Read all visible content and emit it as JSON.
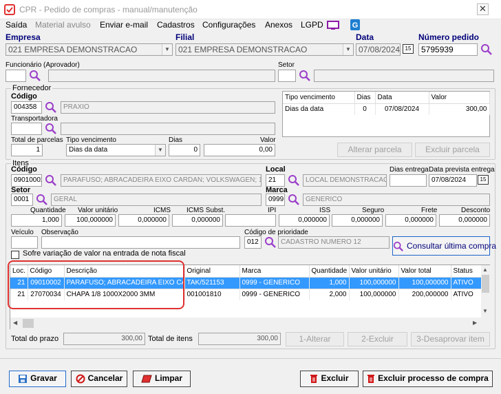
{
  "window": {
    "title": "CPR - Pedido de compras - manual/manutenção",
    "close": "✕"
  },
  "menu": [
    {
      "label": "Saída",
      "enabled": true
    },
    {
      "label": "Material avulso",
      "enabled": false
    },
    {
      "label": "Enviar e-mail",
      "enabled": true
    },
    {
      "label": "Cadastros",
      "enabled": true
    },
    {
      "label": "Configurações",
      "enabled": true
    },
    {
      "label": "Anexos",
      "enabled": true
    },
    {
      "label": "LGPD",
      "enabled": true
    }
  ],
  "header": {
    "empresa_label": "Empresa",
    "empresa_value": "021 EMPRESA DEMONSTRACAO",
    "filial_label": "Filial",
    "filial_value": "021 EMPRESA DEMONSTRACAO",
    "data_label": "Data",
    "data_value": "07/08/2024",
    "cal_icon": "15",
    "numero_label": "Número pedido",
    "numero_value": "5795939",
    "funcionario_label": "Funcionário (Aprovador)",
    "setor_label": "Setor"
  },
  "fornecedor": {
    "title": "Fornecedor",
    "codigo_label": "Código",
    "codigo_value": "004358",
    "nome_value": "PRAXIO",
    "transportadora_label": "Transportadora",
    "total_parcelas_label": "Total de parcelas",
    "total_parcelas_value": "1",
    "tipo_vencimento_label": "Tipo vencimento",
    "tipo_vencimento_value": "Dias da data",
    "dias_label": "Dias",
    "dias_value": "0",
    "valor_label": "Valor",
    "valor_value": "0,00",
    "parcelas_headers": [
      "Tipo vencimento",
      "Dias",
      "Data",
      "Valor"
    ],
    "parcelas_rows": [
      [
        "Dias da data",
        "0",
        "07/08/2024",
        "300,00"
      ]
    ],
    "alterar_parcela": "Alterar parcela",
    "excluir_parcela": "Excluir parcela"
  },
  "itens": {
    "title": "Itens",
    "codigo_label": "Código",
    "codigo_value": "09010002",
    "descricao_value": "PARAFUSO; ABRACADEIRA EIXO CARDAN; VOLKSWAGEN; 17.2(",
    "local_label": "Local",
    "local_value": "21",
    "local_desc": "LOCAL DEMONSTRACAO",
    "dias_entrega_label": "Dias entrega",
    "data_prevista_label": "Data prevista entrega",
    "data_prevista_value": "07/08/2024",
    "setor_label": "Setor",
    "setor_value": "0001",
    "setor_desc": "GERAL",
    "marca_label": "Marca",
    "marca_value": "0999",
    "marca_desc": "GENERICO",
    "quantidade_label": "Quantidade",
    "quantidade_value": "1,000",
    "valor_unitario_label": "Valor unitário",
    "valor_unitario_value": "100,000000",
    "icms_label": "ICMS",
    "icms_value": "0,000000",
    "icms_subst_label": "ICMS Subst.",
    "icms_subst_value": "0,000000",
    "ipi_label": "IPI",
    "ipi_value": "0,000000",
    "iss_label": "ISS",
    "iss_value": "0,000000",
    "seguro_label": "Seguro",
    "seguro_value": "0,000000",
    "frete_label": "Frete",
    "frete_value": "0,000000",
    "desconto_label": "Desconto",
    "desconto_value": "0,000000",
    "veiculo_label": "Veículo",
    "observacao_label": "Observação",
    "prioridade_label": "Código de prioridade",
    "prioridade_value": "012",
    "prioridade_desc": "CADASTRO NUMERO 12",
    "consultar_button": "Consultar última compra",
    "sobre_variacao_label": "Sofre variação de valor na entrada de nota fiscal"
  },
  "grid": {
    "headers": [
      "Loc.",
      "Código",
      "Descrição",
      "Original",
      "Marca",
      "Quantidade",
      "Valor unitário",
      "Valor total",
      "Status"
    ],
    "rows": [
      [
        "21",
        "09010002",
        "PARAFUSO; ABRACADEIRA EIXO CA...",
        "TAK/521153",
        "0999 - GENERICO",
        "1,000",
        "100,000000",
        "100,000000",
        "ATIVO"
      ],
      [
        "21",
        "27070034",
        "CHAPA 1/8 1000X2000 3MM",
        "001001810",
        "0999 - GENERICO",
        "2,000",
        "100,000000",
        "200,000000",
        "ATIVO"
      ]
    ]
  },
  "totals": {
    "total_prazo_label": "Total do prazo",
    "total_prazo_value": "300,00",
    "total_itens_label": "Total de itens",
    "total_itens_value": "300,00",
    "alterar": "1-Alterar",
    "excluir": "2-Excluir",
    "desaprovar": "3-Desaprovar item"
  },
  "footer": {
    "gravar": "Gravar",
    "cancelar": "Cancelar",
    "limpar": "Limpar",
    "excluir": "Excluir",
    "excluir_processo": "Excluir processo de compra"
  },
  "colors": {
    "selection": "#3399ff",
    "highlight": "#e03030",
    "accent": "#00007a"
  }
}
